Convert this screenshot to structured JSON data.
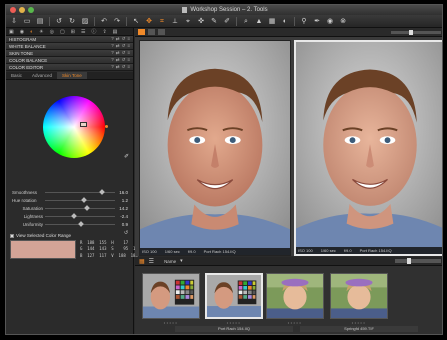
{
  "window": {
    "title": "Workshop Session – 2. Tools",
    "traffic_colors": [
      "#ee5d55",
      "#e3b34a",
      "#59b84c"
    ]
  },
  "toolbar": {
    "icons": [
      "import-icon",
      "capture-icon",
      "folder-icon",
      "rotate-left-icon",
      "rotate-right-icon",
      "trash-icon",
      "undo-icon",
      "redo-icon",
      "cursor-icon",
      "pan-icon",
      "crop-icon",
      "straighten-icon",
      "keystone-icon",
      "heal-icon",
      "brush-icon",
      "white-balance-picker-icon",
      "zoom-icon",
      "warning-icon",
      "levels-icon",
      "flip-icon",
      "loupe-icon",
      "pen-icon",
      "camera-icon",
      "exposure-icon"
    ],
    "glyphs": [
      "⇩",
      "▭",
      "▤",
      "↺",
      "↻",
      "▨",
      "↶",
      "↷",
      "↖",
      "✥",
      "⌗",
      "⟂",
      "⌖",
      "✜",
      "✎",
      "✐",
      "⌕",
      "▲",
      "▦",
      "◐",
      "⚲",
      "✒",
      "◉",
      "⊗"
    ]
  },
  "left_panel": {
    "tabs": [],
    "sections": [
      {
        "label": "HISTOGRAM"
      },
      {
        "label": "WHITE BALANCE"
      },
      {
        "label": "SKIN TONE"
      },
      {
        "label": "COLOR BALANCE"
      },
      {
        "label": "COLOR EDITOR"
      }
    ],
    "subtabs": [
      {
        "label": "Basic",
        "active": false
      },
      {
        "label": "Advanced",
        "active": false
      },
      {
        "label": "Skin Tone",
        "active": true
      }
    ],
    "sliders": [
      {
        "label": "Smoothness",
        "value": "16.0",
        "knob": 0.82
      },
      {
        "label": "Hue rotation",
        "value": "1.2",
        "knob": 0.55
      },
      {
        "label": "Saturation",
        "value": "14.2",
        "knob": 0.6
      },
      {
        "label": "Lightness",
        "value": "-2.4",
        "knob": 0.42
      },
      {
        "label": "Uniformity",
        "value": "0.9",
        "knob": 0.52
      }
    ],
    "view_selected_color_range": "View Selected Color Range",
    "swatch_color": "#d3a497",
    "readout": {
      "rows": [
        "R  188  155  H    17   16",
        "G  144  143  S    95  100",
        "B  127  117  V  188  183"
      ]
    }
  },
  "viewer": {
    "caption_left": {
      "iso": "ISO 100",
      "shutter": "1/60 sec",
      "aperture": "f/9.0",
      "filename": "Port Rach 154.IIQ"
    },
    "caption_right": {
      "iso": "ISO 100",
      "shutter": "1/60 sec",
      "aperture": "f/9.0",
      "filename": "Port Rach 154.IIQ"
    }
  },
  "filmstrip": {
    "name_label": "Name",
    "thumbs": [
      {
        "label": "",
        "kind": "man-chart",
        "selected": false
      },
      {
        "label": "Port Rach 154.IIQ",
        "kind": "man-chart",
        "selected": true
      },
      {
        "label": "",
        "kind": "boy",
        "selected": false
      },
      {
        "label": "Springfd 459.TIF",
        "kind": "boy",
        "selected": false
      }
    ],
    "stars": "•••••"
  },
  "colors": {
    "accent": "#f08a2a",
    "panel_bg": "#2b2b2b",
    "viewer_bg": "#3b3b3b"
  }
}
